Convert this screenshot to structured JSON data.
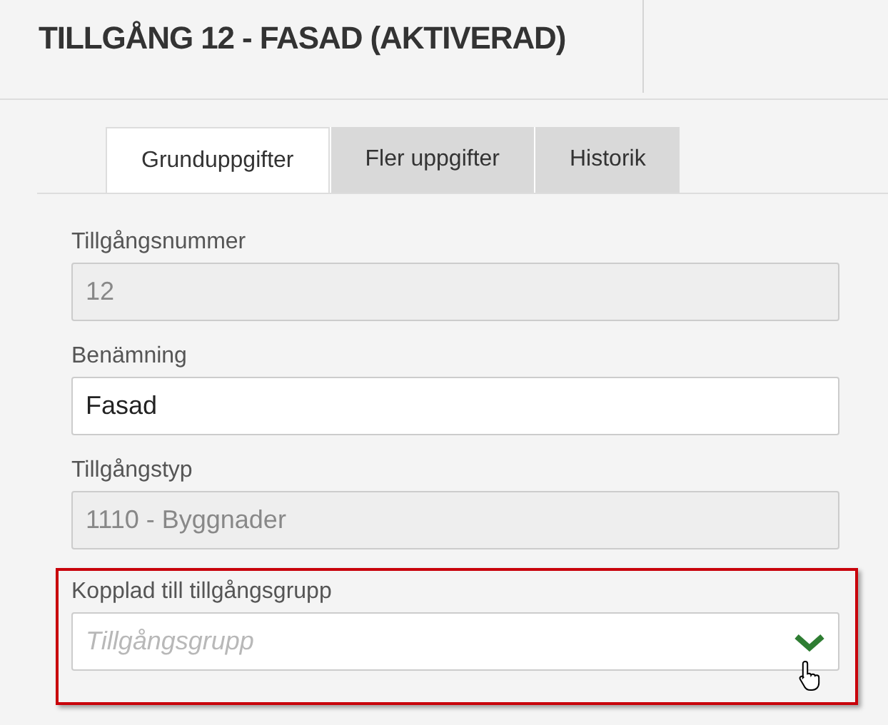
{
  "title": "TILLGÅNG 12 - FASAD (AKTIVERAD)",
  "tabs": [
    {
      "label": "Grunduppgifter",
      "selected": true
    },
    {
      "label": "Fler uppgifter",
      "selected": false
    },
    {
      "label": "Historik",
      "selected": false
    }
  ],
  "fields": [
    {
      "kind": "text",
      "label": "Tillgångsnummer",
      "value": "12",
      "disabled": true,
      "highlighted": false
    },
    {
      "kind": "text",
      "label": "Benämning",
      "value": "Fasad",
      "disabled": false,
      "highlighted": false
    },
    {
      "kind": "text",
      "label": "Tillgångstyp",
      "value": "1110 - Byggnader",
      "disabled": true,
      "highlighted": false
    },
    {
      "kind": "dropdown",
      "label": "Kopplad till tillgångsgrupp",
      "placeholder": "Tillgångsgrupp",
      "disabled": false,
      "highlighted": true
    }
  ]
}
